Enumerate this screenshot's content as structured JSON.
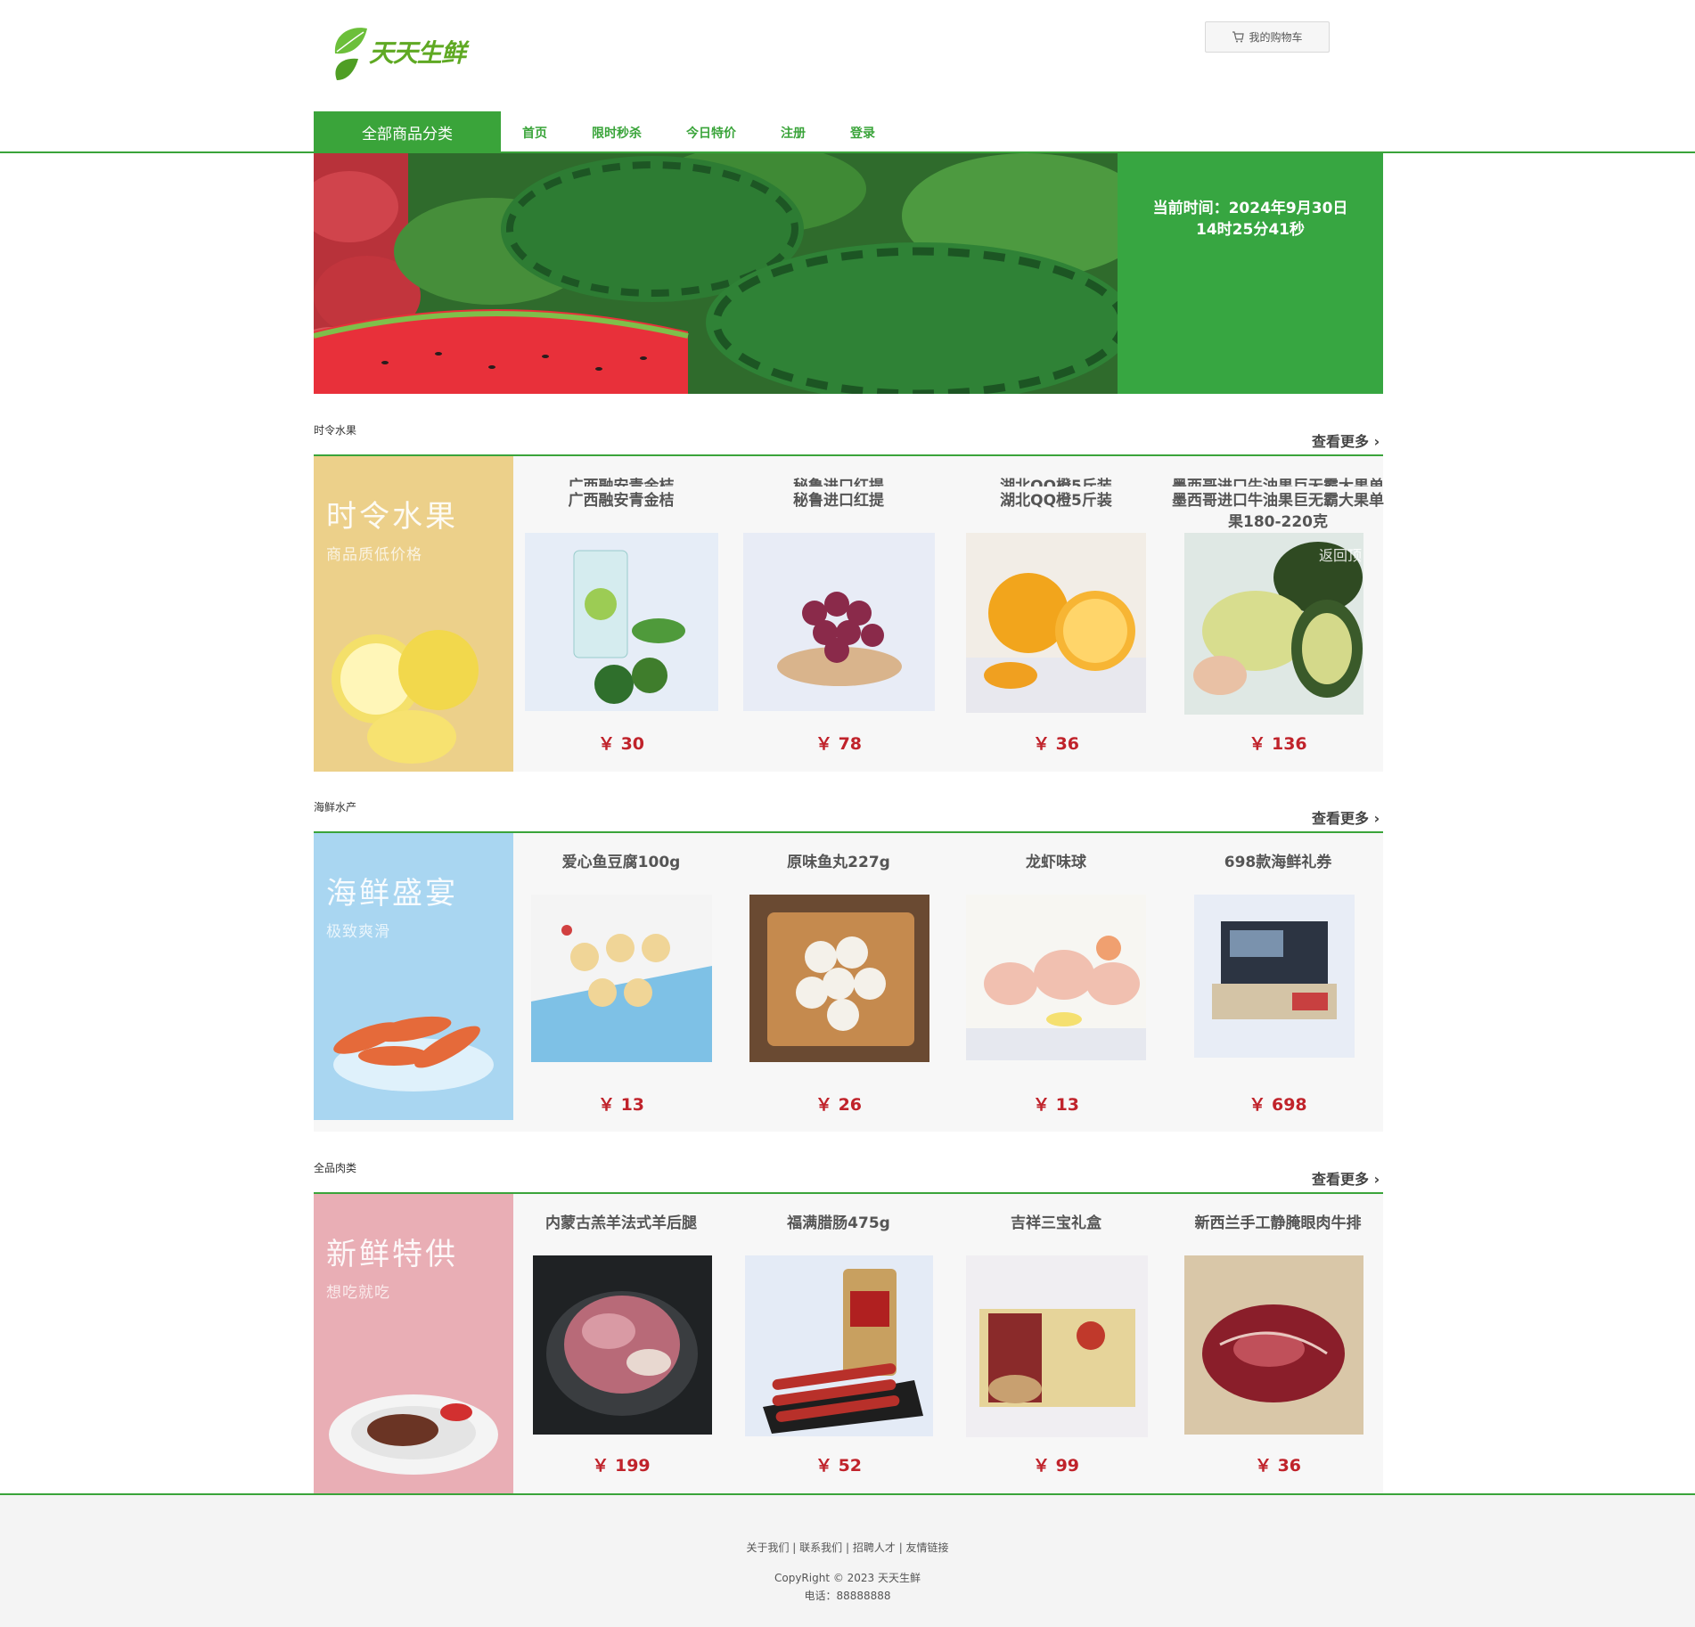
{
  "header": {
    "logo_text": "天天生鲜",
    "cart_label": "我的购物车"
  },
  "nav": {
    "category_label": "全部商品分类",
    "links": [
      "首页",
      "限时秒杀",
      "今日特价",
      "注册",
      "登录"
    ]
  },
  "time_box": {
    "line1": "当前时间：2024年9月30日",
    "line2": "14时25分41秒"
  },
  "sections": [
    {
      "title": "时令水果",
      "more": "查看更多",
      "banner_title": "时令水果",
      "banner_sub": "商品质低价格",
      "products": [
        {
          "name": "广西融安青金桔",
          "price": "￥ 30"
        },
        {
          "name": "秘鲁进口红提",
          "price": "￥ 78"
        },
        {
          "name": "湖北QQ橙5斤装",
          "price": "￥ 36"
        },
        {
          "name": "墨西哥进口牛油果巨无霸大果单果180-220克",
          "price": "￥ 136"
        }
      ],
      "overlay_text": "返回顶"
    },
    {
      "title": "海鲜水产",
      "more": "查看更多",
      "banner_title": "海鲜盛宴",
      "banner_sub": "极致爽滑",
      "products": [
        {
          "name": "爱心鱼豆腐100g",
          "price": "￥ 13"
        },
        {
          "name": "原味鱼丸227g",
          "price": "￥ 26"
        },
        {
          "name": "龙虾味球",
          "price": "￥ 13"
        },
        {
          "name": "698款海鲜礼券",
          "price": "￥ 698"
        }
      ]
    },
    {
      "title": "全品肉类",
      "more": "查看更多",
      "banner_title": "新鲜特供",
      "banner_sub": "想吃就吃",
      "products": [
        {
          "name": "内蒙古羔羊法式羊后腿",
          "price": "￥ 199"
        },
        {
          "name": "福满腊肠475g",
          "price": "￥ 52"
        },
        {
          "name": "吉祥三宝礼盒",
          "price": "￥ 99"
        },
        {
          "name": "新西兰手工静腌眼肉牛排",
          "price": "￥ 36"
        }
      ]
    }
  ],
  "footer": {
    "links": [
      "关于我们",
      "联系我们",
      "招聘人才",
      "友情链接"
    ],
    "copyright": "CopyRight © 2023 天天生鲜",
    "phone": "电话：88888888"
  },
  "colors": {
    "brand_green": "#3aa43a",
    "price_red": "#c0232b"
  }
}
